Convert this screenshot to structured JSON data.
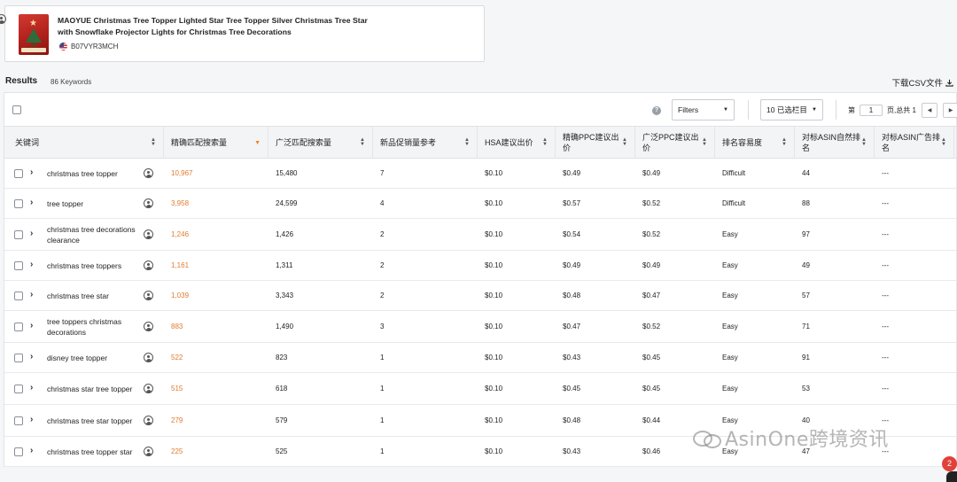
{
  "product": {
    "title_line1": "MAOYUE Christmas Tree Topper Lighted Star Tree Topper Silver Christmas Tree Star",
    "title_line2": "with Snowflake Projector Lights for Christmas Tree Decorations",
    "asin": "B07VYR3MCH",
    "marketplace_icon": "us-flag-icon"
  },
  "results": {
    "label": "Results",
    "count": "86 Keywords",
    "download_label": "下载CSV文件"
  },
  "toolbar": {
    "filters_label": "Filters",
    "columns_label": "10 已选栏目",
    "page_prefix": "第",
    "page_value": "1",
    "page_suffix": "页,总共 1"
  },
  "table": {
    "columns": [
      {
        "label": "关键词"
      },
      {
        "label": "精确匹配搜索量"
      },
      {
        "label": "广泛匹配搜索量"
      },
      {
        "label": "新品促销量参考"
      },
      {
        "label": "HSA建议出价"
      },
      {
        "label": "精确PPC建议出价"
      },
      {
        "label": "广泛PPC建议出价"
      },
      {
        "label": "排名容易度"
      },
      {
        "label": "对标ASIN自然排名"
      },
      {
        "label": "对标ASIN广告排名"
      }
    ],
    "rows": [
      {
        "keyword": "christmas tree topper",
        "exact": "10,967",
        "broad": "15,480",
        "promo": "7",
        "hsa": "$0.10",
        "exact_ppc": "$0.49",
        "broad_ppc": "$0.49",
        "ease": "Difficult",
        "organic": "44",
        "ad": "---"
      },
      {
        "keyword": "tree topper",
        "exact": "3,958",
        "broad": "24,599",
        "promo": "4",
        "hsa": "$0.10",
        "exact_ppc": "$0.57",
        "broad_ppc": "$0.52",
        "ease": "Difficult",
        "organic": "88",
        "ad": "---"
      },
      {
        "keyword": "christmas tree decorations clearance",
        "exact": "1,246",
        "broad": "1,426",
        "promo": "2",
        "hsa": "$0.10",
        "exact_ppc": "$0.54",
        "broad_ppc": "$0.52",
        "ease": "Easy",
        "organic": "97",
        "ad": "---"
      },
      {
        "keyword": "christmas tree toppers",
        "exact": "1,161",
        "broad": "1,311",
        "promo": "2",
        "hsa": "$0.10",
        "exact_ppc": "$0.49",
        "broad_ppc": "$0.49",
        "ease": "Easy",
        "organic": "49",
        "ad": "---"
      },
      {
        "keyword": "christmas tree star",
        "exact": "1,039",
        "broad": "3,343",
        "promo": "2",
        "hsa": "$0.10",
        "exact_ppc": "$0.48",
        "broad_ppc": "$0.47",
        "ease": "Easy",
        "organic": "57",
        "ad": "---"
      },
      {
        "keyword": "tree toppers christmas decorations",
        "exact": "883",
        "broad": "1,490",
        "promo": "3",
        "hsa": "$0.10",
        "exact_ppc": "$0.47",
        "broad_ppc": "$0.52",
        "ease": "Easy",
        "organic": "71",
        "ad": "---"
      },
      {
        "keyword": "disney tree topper",
        "exact": "522",
        "broad": "823",
        "promo": "1",
        "hsa": "$0.10",
        "exact_ppc": "$0.43",
        "broad_ppc": "$0.45",
        "ease": "Easy",
        "organic": "91",
        "ad": "---"
      },
      {
        "keyword": "christmas star tree topper",
        "exact": "515",
        "broad": "618",
        "promo": "1",
        "hsa": "$0.10",
        "exact_ppc": "$0.45",
        "broad_ppc": "$0.45",
        "ease": "Easy",
        "organic": "53",
        "ad": "---"
      },
      {
        "keyword": "christmas tree star topper",
        "exact": "279",
        "broad": "579",
        "promo": "1",
        "hsa": "$0.10",
        "exact_ppc": "$0.48",
        "broad_ppc": "$0.44",
        "ease": "Easy",
        "organic": "40",
        "ad": "---"
      },
      {
        "keyword": "christmas tree topper star",
        "exact": "225",
        "broad": "525",
        "promo": "1",
        "hsa": "$0.10",
        "exact_ppc": "$0.43",
        "broad_ppc": "$0.46",
        "ease": "Easy",
        "organic": "47",
        "ad": "---"
      }
    ]
  },
  "watermark": "AsinOne跨境资讯",
  "notification_badge": "2"
}
